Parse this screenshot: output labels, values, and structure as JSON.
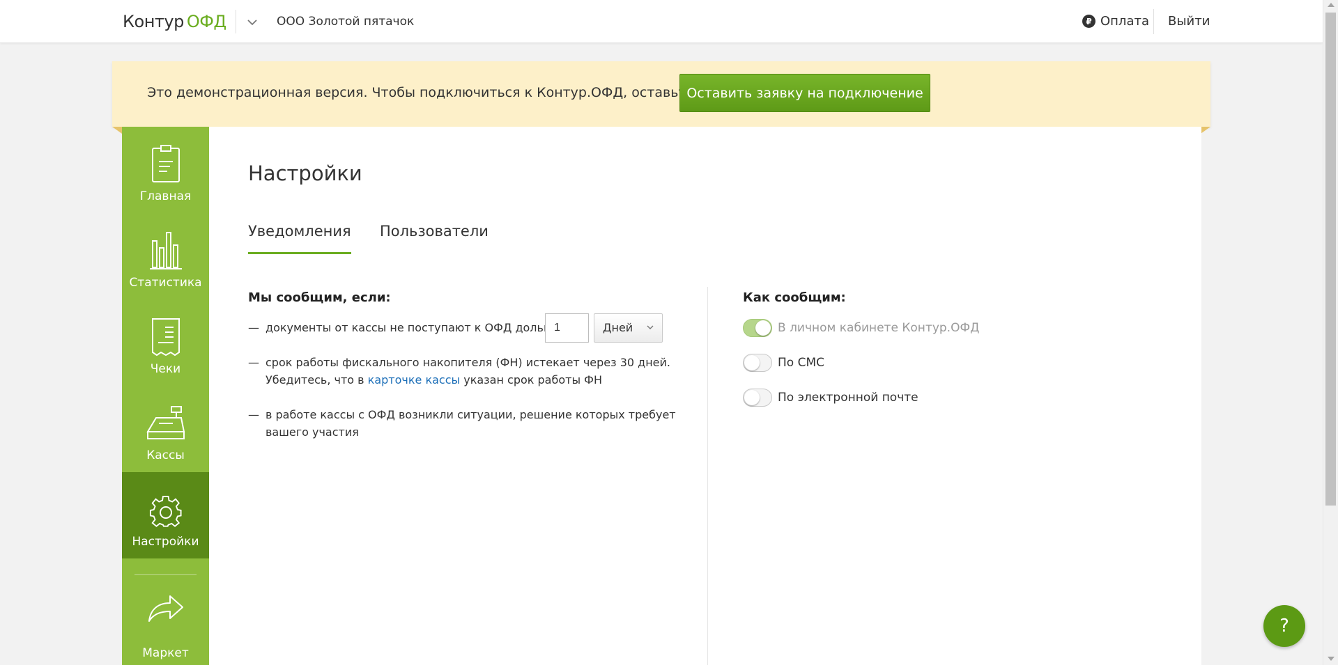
{
  "header": {
    "logo_part1": "Контур",
    "logo_part2": "ОФД",
    "org_name": "ООО Золотой пятачок",
    "pay_label": "Оплата",
    "pay_icon": "ruble-icon",
    "logout_label": "Выйти"
  },
  "banner": {
    "text": "Это демонстрационная версия. Чтобы подключиться к Контур.ОФД, оставьте заявку",
    "button_label": "Оставить заявку на подключение"
  },
  "sidebar": {
    "items": [
      {
        "label": "Главная",
        "icon": "clipboard-icon",
        "active": false
      },
      {
        "label": "Статистика",
        "icon": "bar-chart-icon",
        "active": false
      },
      {
        "label": "Чеки",
        "icon": "receipt-icon",
        "active": false
      },
      {
        "label": "Кассы",
        "icon": "cash-register-icon",
        "active": false
      },
      {
        "label": "Настройки",
        "icon": "gear-icon",
        "active": true
      },
      {
        "label": "Маркет",
        "icon": "share-arrow-icon",
        "active": false
      }
    ]
  },
  "main": {
    "title": "Настройки",
    "tabs": [
      {
        "label": "Уведомления",
        "active": true
      },
      {
        "label": "Пользователи",
        "active": false
      }
    ],
    "left": {
      "title": "Мы сообщим, если:",
      "dash": "—",
      "item1_text": "документы от кассы не поступают к ОФД дольше",
      "item1_value": "1",
      "item1_unit": "Дней",
      "item2_line1": "срок работы фискального накопителя (ФН) истекает через 30 дней.",
      "item2_line2_pre": "Убедитесь, что в",
      "item2_link": "карточке кассы",
      "item2_line2_post": "указан срок работы ФН",
      "item3_line1": "в работе кассы с ОФД возникли ситуации, решение которых требует",
      "item3_line2": "вашего участия"
    },
    "right": {
      "title": "Как сообщим:",
      "options": [
        {
          "label": "В личном кабинете Контур.ОФД",
          "on": true,
          "disabled": true
        },
        {
          "label": "По СМС",
          "on": false,
          "disabled": false
        },
        {
          "label": "По электронной почте",
          "on": false,
          "disabled": false
        }
      ]
    }
  },
  "help_label": "?",
  "colors": {
    "brand_green": "#6aad1f",
    "sidebar_green": "#8dbd3b",
    "sidebar_active": "#5a8a17",
    "banner_bg": "#fdf0c9",
    "link": "#1d6fb8"
  }
}
